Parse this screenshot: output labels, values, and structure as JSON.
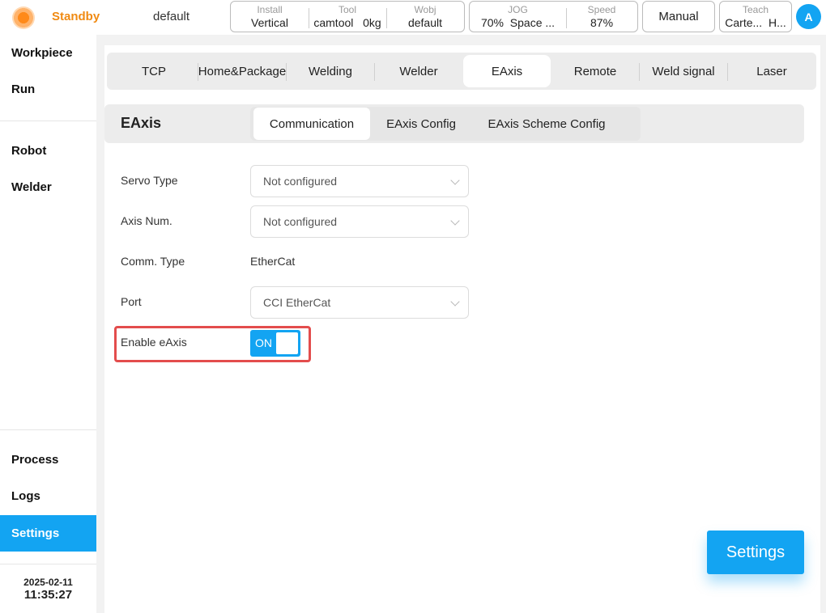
{
  "topbar": {
    "status": "Standby",
    "program": "default",
    "install": {
      "label": "Install",
      "value": "Vertical"
    },
    "tool": {
      "label": "Tool",
      "name": "camtool",
      "load": "0kg"
    },
    "wobj": {
      "label": "Wobj",
      "value": "default"
    },
    "jog": {
      "label": "JOG",
      "percent": "70%",
      "mode": "Space ..."
    },
    "speed": {
      "label": "Speed",
      "value": "87%"
    },
    "mode_button": "Manual",
    "teach": {
      "label": "Teach",
      "value1": "Carte...",
      "value2": "H..."
    },
    "avatar": "A"
  },
  "sidebar": {
    "items": [
      {
        "label": "Workpiece"
      },
      {
        "label": "Run"
      },
      {
        "label": "Robot"
      },
      {
        "label": "Welder"
      },
      {
        "label": "Process"
      },
      {
        "label": "Logs"
      },
      {
        "label": "Settings"
      }
    ],
    "date": "2025-02-11",
    "time": "11:35:27"
  },
  "main": {
    "tabs": [
      {
        "label": "TCP"
      },
      {
        "label": "Home&Package"
      },
      {
        "label": "Welding"
      },
      {
        "label": "Welder"
      },
      {
        "label": "EAxis"
      },
      {
        "label": "Remote"
      },
      {
        "label": "Weld signal"
      },
      {
        "label": "Laser"
      }
    ],
    "section_title": "EAxis",
    "subtabs": [
      {
        "label": "Communication"
      },
      {
        "label": "EAxis Config"
      },
      {
        "label": "EAxis Scheme Config"
      }
    ],
    "form": {
      "servo_type": {
        "label": "Servo Type",
        "value": "Not configured"
      },
      "axis_num": {
        "label": "Axis Num.",
        "value": "Not configured"
      },
      "comm_type": {
        "label": "Comm. Type",
        "value": "EtherCat"
      },
      "port": {
        "label": "Port",
        "value": "CCI EtherCat"
      },
      "enable_eaxis": {
        "label": "Enable eAxis",
        "state": "ON"
      }
    },
    "settings_button": "Settings"
  },
  "colors": {
    "accent": "#13a4f2",
    "status": "#f08a12",
    "highlight": "#e34d4d"
  }
}
